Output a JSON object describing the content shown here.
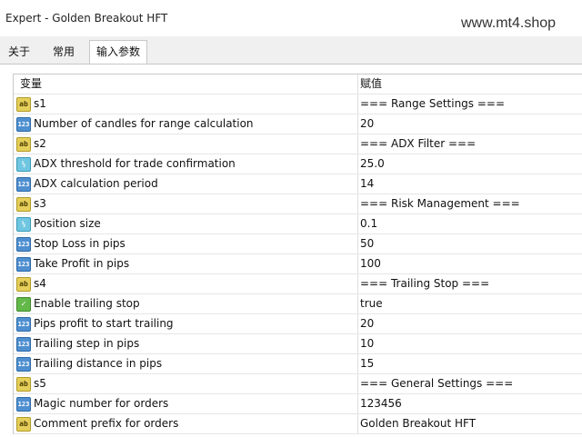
{
  "window": {
    "title": "Expert - Golden Breakout HFT",
    "watermark": "www.mt4.shop"
  },
  "tabs": [
    {
      "label": "关于"
    },
    {
      "label": "常用"
    },
    {
      "label": "输入参数"
    }
  ],
  "table": {
    "headers": [
      "变量",
      "赋值"
    ],
    "rows": [
      {
        "icon": "ab",
        "name": "s1",
        "value": "=== Range Settings ==="
      },
      {
        "icon": "123",
        "name": "Number of candles for range calculation",
        "value": "20"
      },
      {
        "icon": "ab",
        "name": "s2",
        "value": "=== ADX Filter ==="
      },
      {
        "icon": "v2",
        "name": "ADX threshold for trade confirmation",
        "value": "25.0"
      },
      {
        "icon": "123",
        "name": "ADX calculation period",
        "value": "14"
      },
      {
        "icon": "ab",
        "name": "s3",
        "value": "=== Risk Management ==="
      },
      {
        "icon": "v2",
        "name": "Position size",
        "value": "0.1"
      },
      {
        "icon": "123",
        "name": "Stop Loss in pips",
        "value": "50"
      },
      {
        "icon": "123",
        "name": "Take Profit in pips",
        "value": "100"
      },
      {
        "icon": "ab",
        "name": "s4",
        "value": "=== Trailing Stop ==="
      },
      {
        "icon": "bool",
        "name": "Enable trailing stop",
        "value": "true"
      },
      {
        "icon": "123",
        "name": "Pips profit to start trailing",
        "value": "20"
      },
      {
        "icon": "123",
        "name": "Trailing step in pips",
        "value": "10"
      },
      {
        "icon": "123",
        "name": "Trailing distance in pips",
        "value": "15"
      },
      {
        "icon": "ab",
        "name": "s5",
        "value": "=== General Settings ==="
      },
      {
        "icon": "123",
        "name": "Magic number for orders",
        "value": "123456"
      },
      {
        "icon": "ab",
        "name": "Comment prefix for orders",
        "value": "Golden Breakout HFT"
      }
    ]
  }
}
